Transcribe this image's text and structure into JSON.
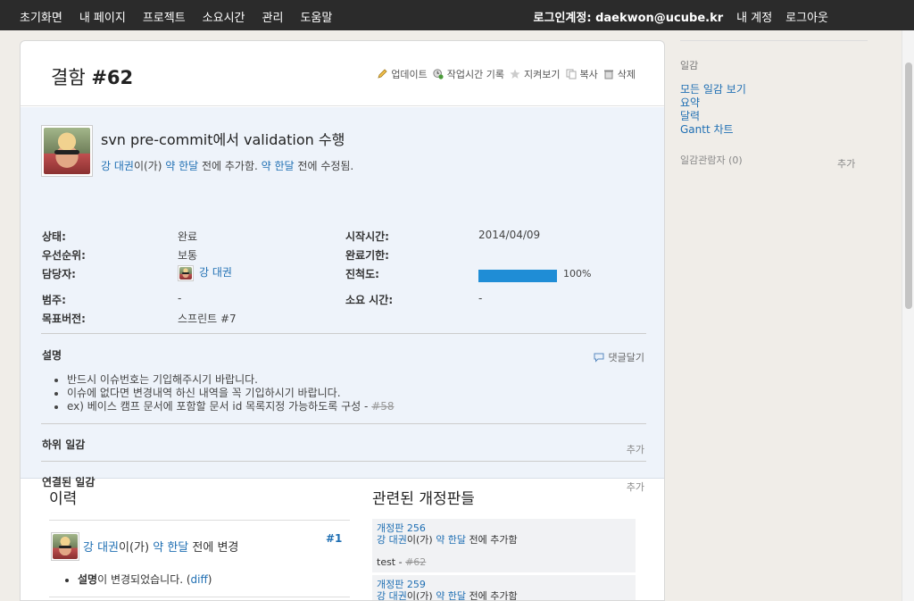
{
  "topbar": {
    "nav": [
      "초기화면",
      "내 페이지",
      "프로젝트",
      "소요시간",
      "관리",
      "도움말"
    ],
    "login_label": "로그인계정:",
    "login_user": "daekwon@ucube.kr",
    "my_account": "내 계정",
    "logout": "로그아웃"
  },
  "issue": {
    "title_prefix": "결함",
    "title_number": "#62",
    "actions": {
      "update": "업데이트",
      "log_time": "작업시간 기록",
      "watch": "지켜보기",
      "copy": "복사",
      "delete": "삭제"
    },
    "subject": "svn pre-commit에서 validation 수행",
    "author": "강 대권",
    "author_suffix": "이(가)",
    "created_ago": "약 한달",
    "created_suffix": "전에 추가함.",
    "updated_ago": "약 한달",
    "updated_suffix": "전에 수정됨.",
    "attributes": {
      "status_label": "상태:",
      "status": "완료",
      "start_label": "시작시간:",
      "start": "2014/04/09",
      "priority_label": "우선순위:",
      "priority": "보통",
      "due_label": "완료기한:",
      "due": "",
      "assignee_label": "담당자:",
      "assignee": "강 대권",
      "progress_label": "진척도:",
      "progress_percent": 100,
      "progress_text": "100%",
      "category_label": "범주:",
      "category": "-",
      "spent_label": "소요 시간:",
      "spent": "-",
      "version_label": "목표버전:",
      "version": "스프린트 #7"
    },
    "description": {
      "title": "설명",
      "reply": "댓글달기",
      "items": [
        "반드시 이슈번호는 기입해주시기 바랍니다.",
        "이슈에 없다면 변경내역 하신 내역을 꼭 기입하시기 바랍니다.",
        "ex) 베이스 캠프 문서에 포함할 문서 id 목록지정 가능하도록 구성 - "
      ],
      "item3_link": "#58"
    },
    "subtasks": {
      "title": "하위 일감",
      "add": "추가"
    },
    "relations": {
      "title": "연결된 일감",
      "add": "추가"
    }
  },
  "history": {
    "title": "이력",
    "entry": {
      "user": "강 대권",
      "user_suffix": "이(가)",
      "ago": "약 한달",
      "suffix": "전에 변경",
      "number": "#1",
      "field": "설명",
      "change_text": "이 변경되었습니다. (",
      "diff": "diff",
      "close": ")"
    }
  },
  "revisions": {
    "title": "관련된 개정판들",
    "items": [
      {
        "rev": "개정판 256",
        "user": "강 대권",
        "user_suffix": "이(가)",
        "ago": "약 한달",
        "suffix": "전에 추가함",
        "comment": "test - ",
        "comment_link": "#62"
      },
      {
        "rev": "개정판 259",
        "user": "강 대권",
        "user_suffix": "이(가)",
        "ago": "약 한달",
        "suffix": "전에 추가함"
      }
    ]
  },
  "sidebar": {
    "heading": "일감",
    "links": [
      "모든 일감 보기",
      "요약",
      "달력",
      "Gantt 차트"
    ],
    "watchers": "일감관람자 (0)",
    "watchers_add": "추가"
  }
}
